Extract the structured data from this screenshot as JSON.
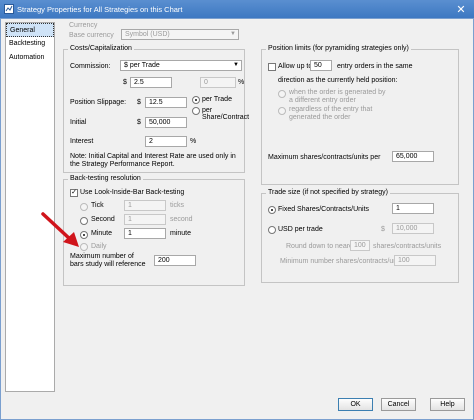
{
  "window": {
    "title": "Strategy Properties for All Strategies on this Chart",
    "close_glyph": "✕"
  },
  "nav": {
    "items": [
      "General",
      "Backtesting",
      "Automation"
    ]
  },
  "currency": {
    "section": "Currency",
    "base_label": "Base currency",
    "base_value": "Symbol (USD)"
  },
  "costs": {
    "title": "Costs/Capitalization",
    "commission_label": "Commission:",
    "commission_type": "$ per Trade",
    "commission_amount": "2.5",
    "commission_percent": "0",
    "dollar": "$",
    "percent": "%",
    "slippage_label": "Position Slippage:",
    "slippage_value": "12.5",
    "per_trade": "per Trade",
    "per_share": "per Share/Contract",
    "initial_label": "Initial",
    "initial_value": "50,000",
    "interest_label": "Interest",
    "interest_value": "2",
    "note": "Note: Initial Capital and Interest Rate are used only in the Strategy Performance Report."
  },
  "position_limits": {
    "title": "Position limits (for pyramiding strategies only)",
    "allow_label": "Allow up to",
    "allow_value": "50",
    "allow_suffix": "entry orders in the same",
    "direction": "direction as the currently held position:",
    "opt1": "when the order is generated by a different entry order",
    "opt2": "regardless of the entry that generated the order",
    "max_label": "Maximum shares/contracts/units per",
    "max_value": "65,000"
  },
  "backtesting": {
    "title": "Back-testing resolution",
    "look_inside": "Use Look-Inside-Bar Back-testing",
    "tick_label": "Tick",
    "tick_value": "1",
    "tick_unit": "ticks",
    "second_label": "Second",
    "second_value": "1",
    "second_unit": "second",
    "minute_label": "Minute",
    "minute_value": "1",
    "minute_unit": "minute",
    "daily_label": "Daily",
    "maxbars_label": "Maximum number of bars study will reference",
    "maxbars_value": "200"
  },
  "trade_size": {
    "title": "Trade size (if not specified by strategy)",
    "fixed_label": "Fixed Shares/Contracts/Units",
    "fixed_value": "1",
    "usd_label": "USD per trade",
    "usd_dollar": "$",
    "usd_value": "10,000",
    "round_label": "Round down to nearest",
    "round_value": "100",
    "round_unit": "shares/contracts/units",
    "min_label": "Minimum number shares/contracts/units",
    "min_value": "100"
  },
  "buttons": {
    "ok": "OK",
    "cancel": "Cancel",
    "help": "Help"
  },
  "colors": {
    "titlebar": "#3d78c2",
    "annotation_arrow": "#d0141b",
    "selected_nav": "#cfe3f7"
  }
}
